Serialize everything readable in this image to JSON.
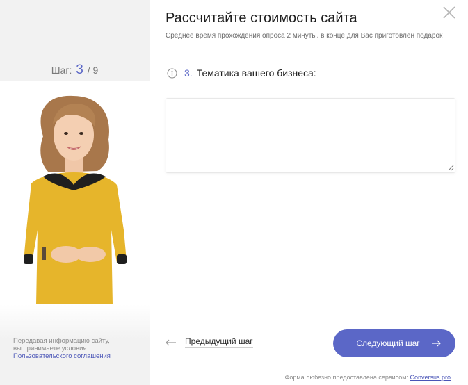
{
  "quiz": {
    "title": "Рассчитайте стоимость сайта",
    "subtitle": "Среднее время прохождения опроса 2 минуты. в конце для Вас приготовлен подарок",
    "step_label": "Шаг:",
    "step_current": "3",
    "step_sep": "/",
    "step_total": "9"
  },
  "question": {
    "number": "3.",
    "text": "Тематика вашего бизнеса:",
    "answer_value": "",
    "answer_placeholder": ""
  },
  "nav": {
    "prev_label": "Предыдущий шаг",
    "next_label": "Следующий шаг"
  },
  "consent": {
    "line1": "Передавая информацию сайту,",
    "line2": "вы принимаете условия",
    "link": "Пользовательского соглашения"
  },
  "footer": {
    "text": "Форма любезно предоставлена сервисом:",
    "link": "Conversus.pro"
  },
  "colors": {
    "accent": "#5b67c7",
    "panel_bg": "#f2f2f2",
    "shirt": "#e6b52b"
  },
  "icons": {
    "close": "close-icon",
    "info": "info-icon",
    "prev_arrow": "arrow-left-icon",
    "next_arrow": "arrow-right-icon"
  }
}
